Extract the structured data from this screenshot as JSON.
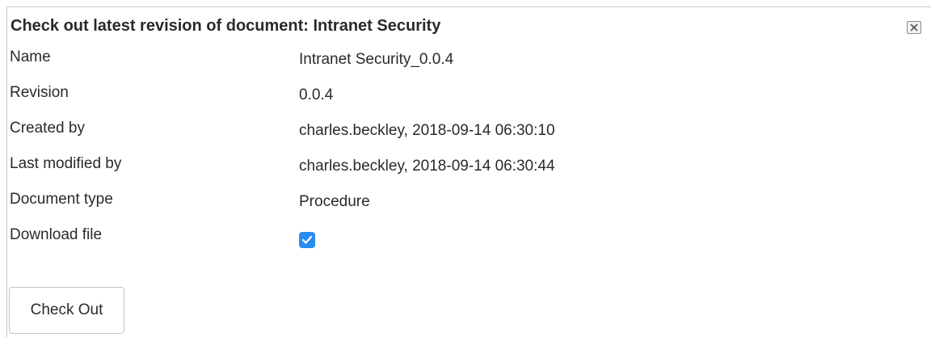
{
  "dialog": {
    "title": "Check out latest revision of document: Intranet Security",
    "close_icon": "close-x-icon"
  },
  "fields": [
    {
      "label": "Name",
      "value": "Intranet Security_0.0.4"
    },
    {
      "label": "Revision",
      "value": "0.0.4"
    },
    {
      "label": "Created by",
      "value": "charles.beckley, 2018-09-14 06:30:10"
    },
    {
      "label": "Last modified by",
      "value": "charles.beckley, 2018-09-14 06:30:44"
    },
    {
      "label": "Document type",
      "value": "Procedure"
    }
  ],
  "download": {
    "label": "Download file",
    "checked": true,
    "checkbox_color": "#2a8cf0"
  },
  "actions": {
    "check_out_label": "Check Out"
  }
}
